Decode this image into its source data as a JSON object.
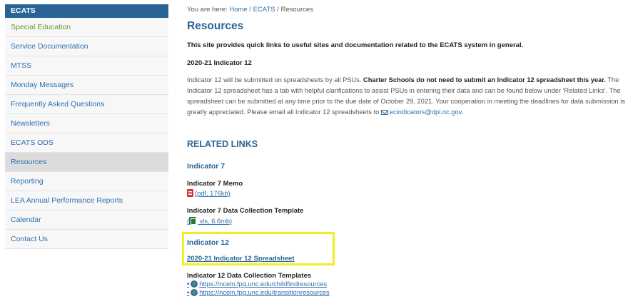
{
  "sidebar": {
    "header": "ECATS",
    "items": [
      {
        "label": "Special Education",
        "state": "green"
      },
      {
        "label": "Service Documentation",
        "state": "normal"
      },
      {
        "label": "MTSS",
        "state": "normal"
      },
      {
        "label": "Monday Messages",
        "state": "normal"
      },
      {
        "label": "Frequently Asked Questions",
        "state": "normal"
      },
      {
        "label": "Newsletters",
        "state": "normal"
      },
      {
        "label": "ECATS ODS",
        "state": "normal"
      },
      {
        "label": "Resources",
        "state": "active"
      },
      {
        "label": "Reporting",
        "state": "normal"
      },
      {
        "label": "LEA Annual Performance Reports",
        "state": "normal"
      },
      {
        "label": "Calendar",
        "state": "normal"
      },
      {
        "label": "Contact Us",
        "state": "normal"
      }
    ]
  },
  "breadcrumb": {
    "prefix": "You are here: ",
    "home": "Home",
    "sep1": " / ",
    "ecats": "ECATS",
    "sep2": " / ",
    "current": "Resources"
  },
  "page": {
    "title": "Resources",
    "intro": "This site provides quick links to useful sites and documentation related to the ECATS system in general.",
    "subhead": "2020-21 Indicator 12",
    "para": {
      "l1a": "Indicator 12 will be submitted on spreadsheets by all PSUs. ",
      "l1b": "Charter Schools do not need to submit an Indicator 12 spreadsheet this year.",
      "l1c": " The",
      "l2": "Indicator 12 spreadsheet has a tab with helpful clarifications to assist PSUs in entering their data and can be found below under 'Related Links'. The",
      "l3": "spreadsheet can be submitted at any time prior to the due date of October 29, 2021. Your cooperation in meeting the deadlines for data submission is",
      "l4a": "greatly appreciated. Please email all Indicator 12 spreadsheets to ",
      "email": "ecindicators@dpi.nc.gov",
      "l4b": "."
    }
  },
  "related": {
    "heading": "RELATED LINKS",
    "ind7": {
      "heading": "Indicator 7",
      "memo_title": "Indicator 7 Memo",
      "memo_link": "(pdf, 176kb)",
      "template_title": "Indicator 7 Data Collection Template",
      "template_link_a": "(",
      "template_link_b": " xls, 6.6mb)"
    },
    "ind12": {
      "heading": "Indicator 12",
      "spreadsheet_link": "2020-21 Indicator 12 Spreadsheet",
      "templates_title": "Indicator 12 Data Collection Templates",
      "links": [
        "https://nceln.fpg.unc.edu/childfindresources",
        "https://nceln.fpg.unc.edu/transitionresources"
      ]
    }
  },
  "colors": {
    "highlight": "#f0ee1e",
    "sidebar_header": "#2a6496",
    "link": "#2f6fae"
  }
}
